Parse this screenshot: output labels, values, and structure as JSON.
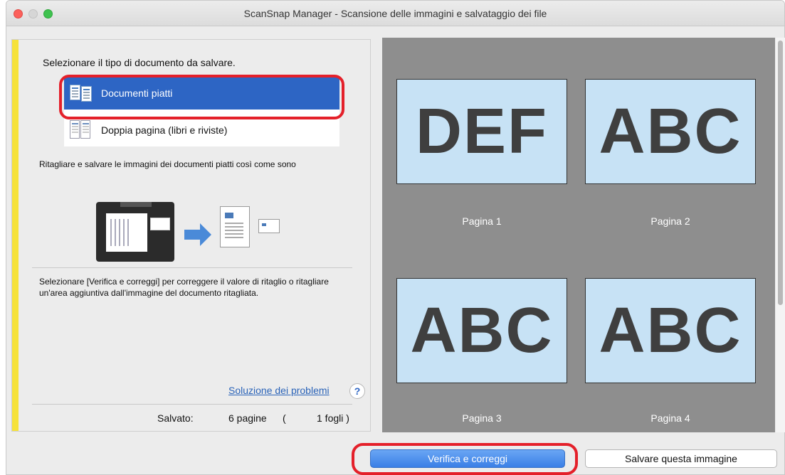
{
  "window": {
    "title": "ScanSnap Manager - Scansione delle immagini e salvataggio dei file"
  },
  "left": {
    "prompt": "Selezionare il tipo di documento da salvare.",
    "types": [
      {
        "label": "Documenti piatti",
        "selected": true
      },
      {
        "label": "Doppia pagina (libri e riviste)",
        "selected": false
      }
    ],
    "type_description": "Ritagliare e salvare le immagini dei documenti piatti così come sono",
    "verify_hint": "Selezionare [Verifica e correggi] per correggere il valore di ritaglio o ritagliare un'area aggiuntiva dall'immagine del documento ritagliata.",
    "troubleshoot_link": "Soluzione dei problemi",
    "help_symbol": "?",
    "saved_label": "Salvato:",
    "saved_pages": "6 pagine",
    "saved_paren_open": "(",
    "saved_sheets": "1 fogli )"
  },
  "preview": {
    "pages": [
      {
        "text": "DEF",
        "label": "Pagina 1"
      },
      {
        "text": "ABC",
        "label": "Pagina 2"
      },
      {
        "text": "ABC",
        "label": "Pagina 3"
      },
      {
        "text": "ABC",
        "label": "Pagina 4"
      }
    ]
  },
  "buttons": {
    "verify": "Verifica e correggi",
    "save": "Salvare questa immagine"
  },
  "colors": {
    "accent": "#2d65c4",
    "highlight_ring": "#e4202a",
    "sidebar_marker": "#f6e23a",
    "thumbnail_bg": "#c7e2f5"
  }
}
